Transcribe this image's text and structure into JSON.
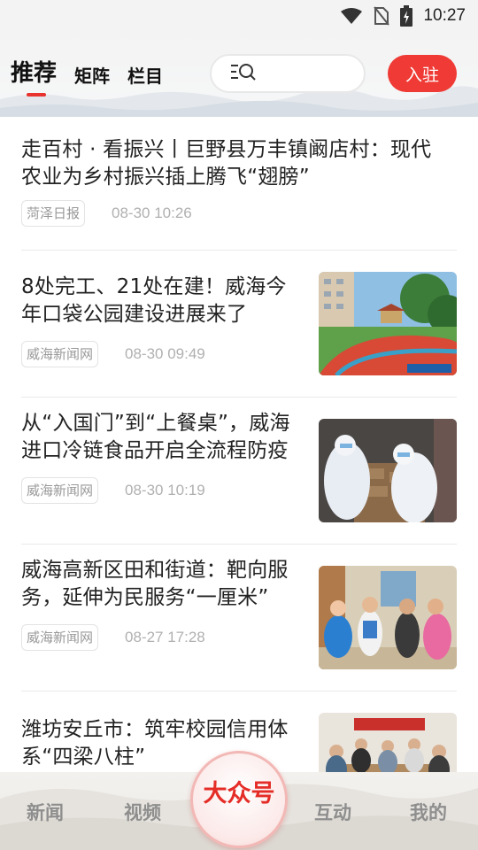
{
  "status_bar": {
    "time": "10:27"
  },
  "header": {
    "tabs": [
      {
        "label": "推荐"
      },
      {
        "label": "矩阵"
      },
      {
        "label": "栏目"
      }
    ],
    "search": {
      "placeholder": ""
    },
    "join_label": "入驻"
  },
  "articles": [
    {
      "title": "走百村 · 看振兴丨巨野县万丰镇阚店村：现代农业为乡村振兴插上腾飞“翅膀”",
      "source": "菏泽日报",
      "time": "08-30 10:26"
    },
    {
      "title": "8处完工、21处在建！威海今年口袋公园建设进展来了",
      "source": "威海新闻网",
      "time": "08-30 09:49"
    },
    {
      "title": "从“入国门”到“上餐桌”，威海进口冷链食品开启全流程防疫",
      "source": "威海新闻网",
      "time": "08-30 10:19"
    },
    {
      "title": "威海高新区田和街道：靶向服务，延伸为民服务“一厘米”",
      "source": "威海新闻网",
      "time": "08-27 17:28"
    },
    {
      "title": "潍坊安丘市：筑牢校园信用体系“四梁八柱”",
      "source": "",
      "time": ""
    }
  ],
  "bottom_nav": {
    "items": [
      {
        "label": "新闻"
      },
      {
        "label": "视频"
      },
      {
        "label": "大众号"
      },
      {
        "label": "互动"
      },
      {
        "label": "我的"
      }
    ]
  },
  "colors": {
    "accent": "#ef3a35"
  }
}
